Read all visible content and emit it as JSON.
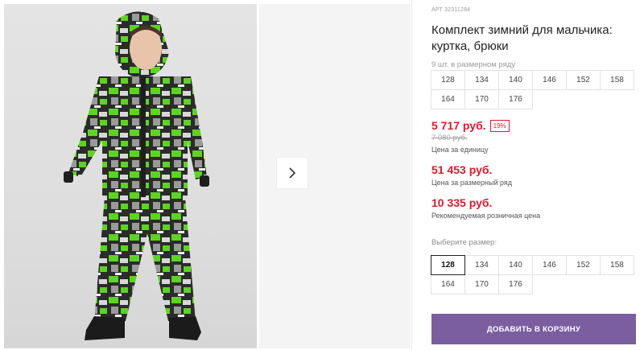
{
  "product": {
    "sku": "АРТ 32311284",
    "title": "Комплект зимний для мальчика: куртка, брюки",
    "sizes_note": "9 шт. в размерном ряду",
    "size_row": [
      "128",
      "134",
      "140",
      "146",
      "152",
      "158",
      "164",
      "170",
      "176"
    ]
  },
  "prices": {
    "unit_price": "5 717 руб.",
    "discount": "19%",
    "old_price": "7 080 руб.",
    "unit_label": "Цена за единицу",
    "row_price": "51 453 руб.",
    "row_label": "Цена за размерный ряд",
    "rrp_price": "10 335 руб.",
    "rrp_label": "Рекомендуемая розничная цена"
  },
  "size_select": {
    "label": "Выберите размер:",
    "options": [
      "128",
      "134",
      "140",
      "146",
      "152",
      "158",
      "164",
      "170",
      "176"
    ],
    "selected": "128"
  },
  "cart": {
    "button_label": "ДОБАВИТЬ В КОРЗИНУ"
  },
  "colors": {
    "accent": "#7b5ea0",
    "price": "#e0182d",
    "jacket_green": "#5ad61e"
  },
  "icons": {
    "next": "chevron-right-icon"
  }
}
